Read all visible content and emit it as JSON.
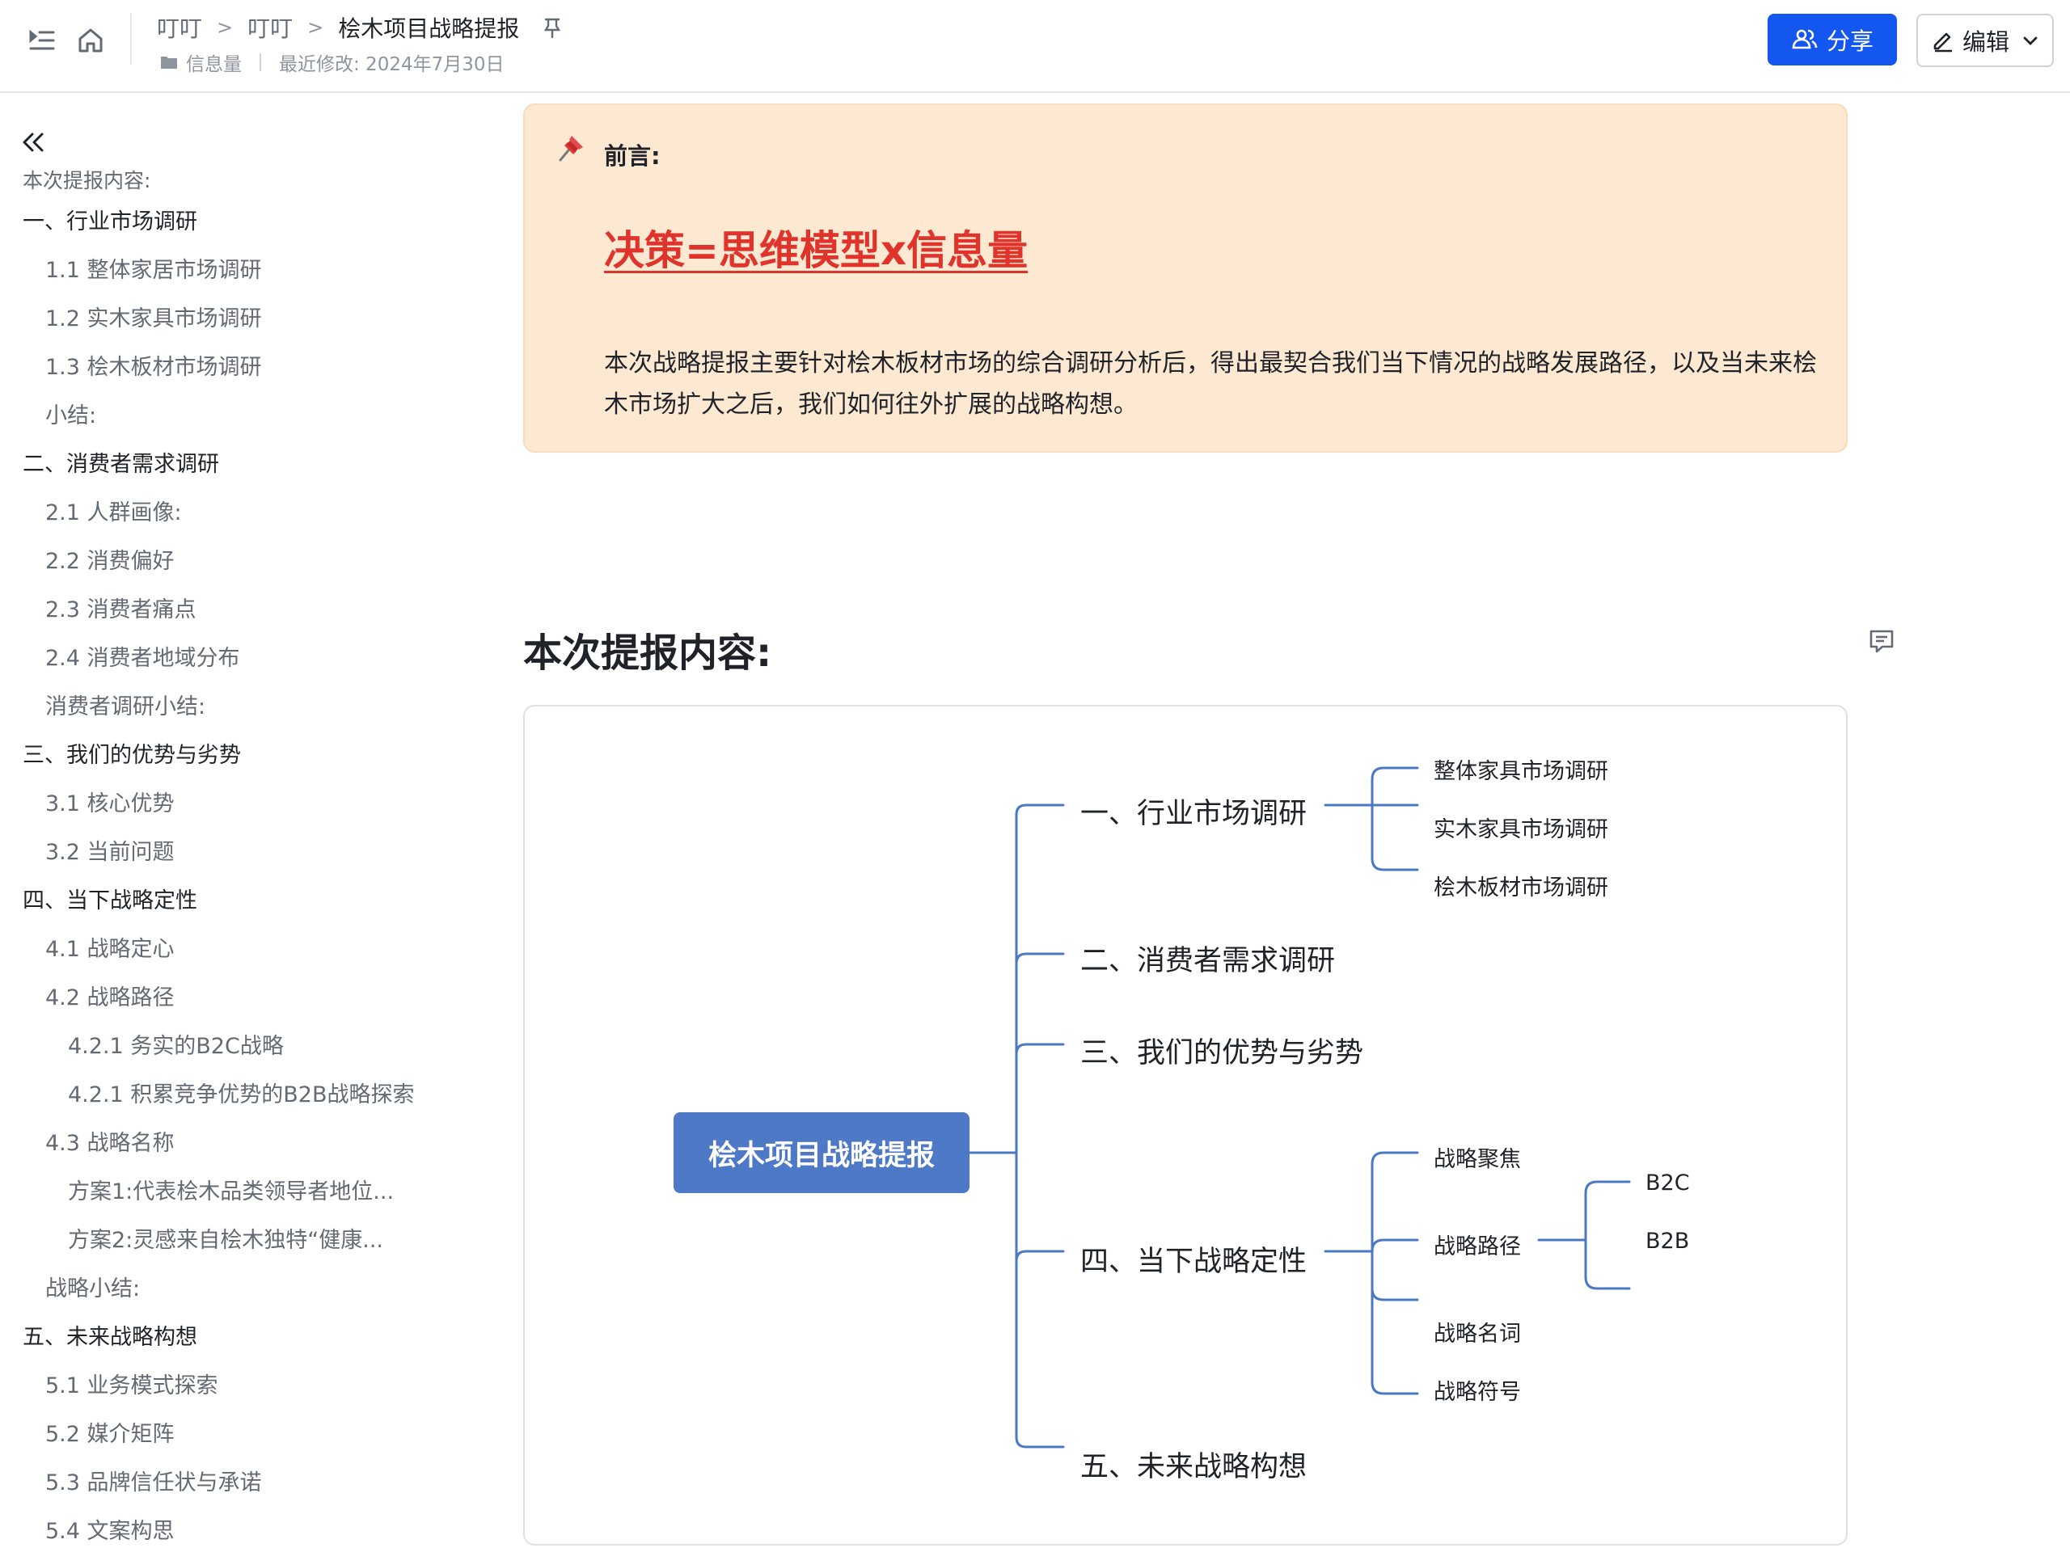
{
  "header": {
    "breadcrumbs": [
      "叮叮",
      "叮叮",
      "桧木项目战略提报"
    ],
    "folder_label": "信息量",
    "last_modified": "最近修改: 2024年7月30日",
    "share_label": "分享",
    "edit_label": "编辑"
  },
  "outline": {
    "items": [
      {
        "label": "本次提报内容:"
      },
      {
        "label": "一、行业市场调研"
      },
      {
        "label": "1.1 整体家居市场调研"
      },
      {
        "label": "1.2 实木家具市场调研"
      },
      {
        "label": "1.3 桧木板材市场调研"
      },
      {
        "label": "小结:"
      },
      {
        "label": "二、消费者需求调研"
      },
      {
        "label": "2.1 人群画像:"
      },
      {
        "label": "2.2 消费偏好"
      },
      {
        "label": "2.3 消费者痛点"
      },
      {
        "label": "2.4 消费者地域分布"
      },
      {
        "label": "消费者调研小结:"
      },
      {
        "label": "三、我们的优势与劣势"
      },
      {
        "label": "3.1 核心优势"
      },
      {
        "label": "3.2 当前问题"
      },
      {
        "label": "四、当下战略定性"
      },
      {
        "label": "4.1 战略定心"
      },
      {
        "label": "4.2 战略路径"
      },
      {
        "label": "4.2.1 务实的B2C战略"
      },
      {
        "label": "4.2.1 积累竞争优势的B2B战略探索"
      },
      {
        "label": "4.3 战略名称"
      },
      {
        "label": "方案1:代表桧木品类领导者地位..."
      },
      {
        "label": "方案2:灵感来自桧木独特“健康..."
      },
      {
        "label": "战略小结:"
      },
      {
        "label": "五、未来战略构想"
      },
      {
        "label": "5.1 业务模式探索"
      },
      {
        "label": "5.2 媒介矩阵"
      },
      {
        "label": "5.3 品牌信任状与承诺"
      },
      {
        "label": "5.4 文案构思"
      }
    ]
  },
  "callout": {
    "label": "前言:",
    "headline": "决策=思维模型x信息量",
    "body": "本次战略提报主要针对桧木板材市场的综合调研分析后，得出最契合我们当下情况的战略发展路径，以及当未来桧木市场扩大之后，我们如何往外扩展的战略构想。"
  },
  "section_heading": "本次提报内容:",
  "mindmap": {
    "root": "桧木项目战略提报",
    "branches": [
      {
        "label": "一、行业市场调研",
        "children": [
          {
            "label": "整体家具市场调研"
          },
          {
            "label": "实木家具市场调研"
          },
          {
            "label": "桧木板材市场调研"
          }
        ]
      },
      {
        "label": "二、消费者需求调研",
        "children": []
      },
      {
        "label": "三、我们的优势与劣势",
        "children": []
      },
      {
        "label": "四、当下战略定性",
        "children": [
          {
            "label": "战略聚焦"
          },
          {
            "label": "战略路径",
            "children": [
              {
                "label": "B2C"
              },
              {
                "label": "B2B"
              }
            ]
          },
          {
            "label": "战略名词"
          },
          {
            "label": "战略符号"
          }
        ]
      },
      {
        "label": "五、未来战略构想",
        "children": []
      }
    ],
    "line_color": "#4a78c2",
    "root_color": "#4e79c7"
  },
  "colors": {
    "primary": "#1456f0",
    "callout_bg": "#fde9d2",
    "headline_red": "#e0332b"
  }
}
